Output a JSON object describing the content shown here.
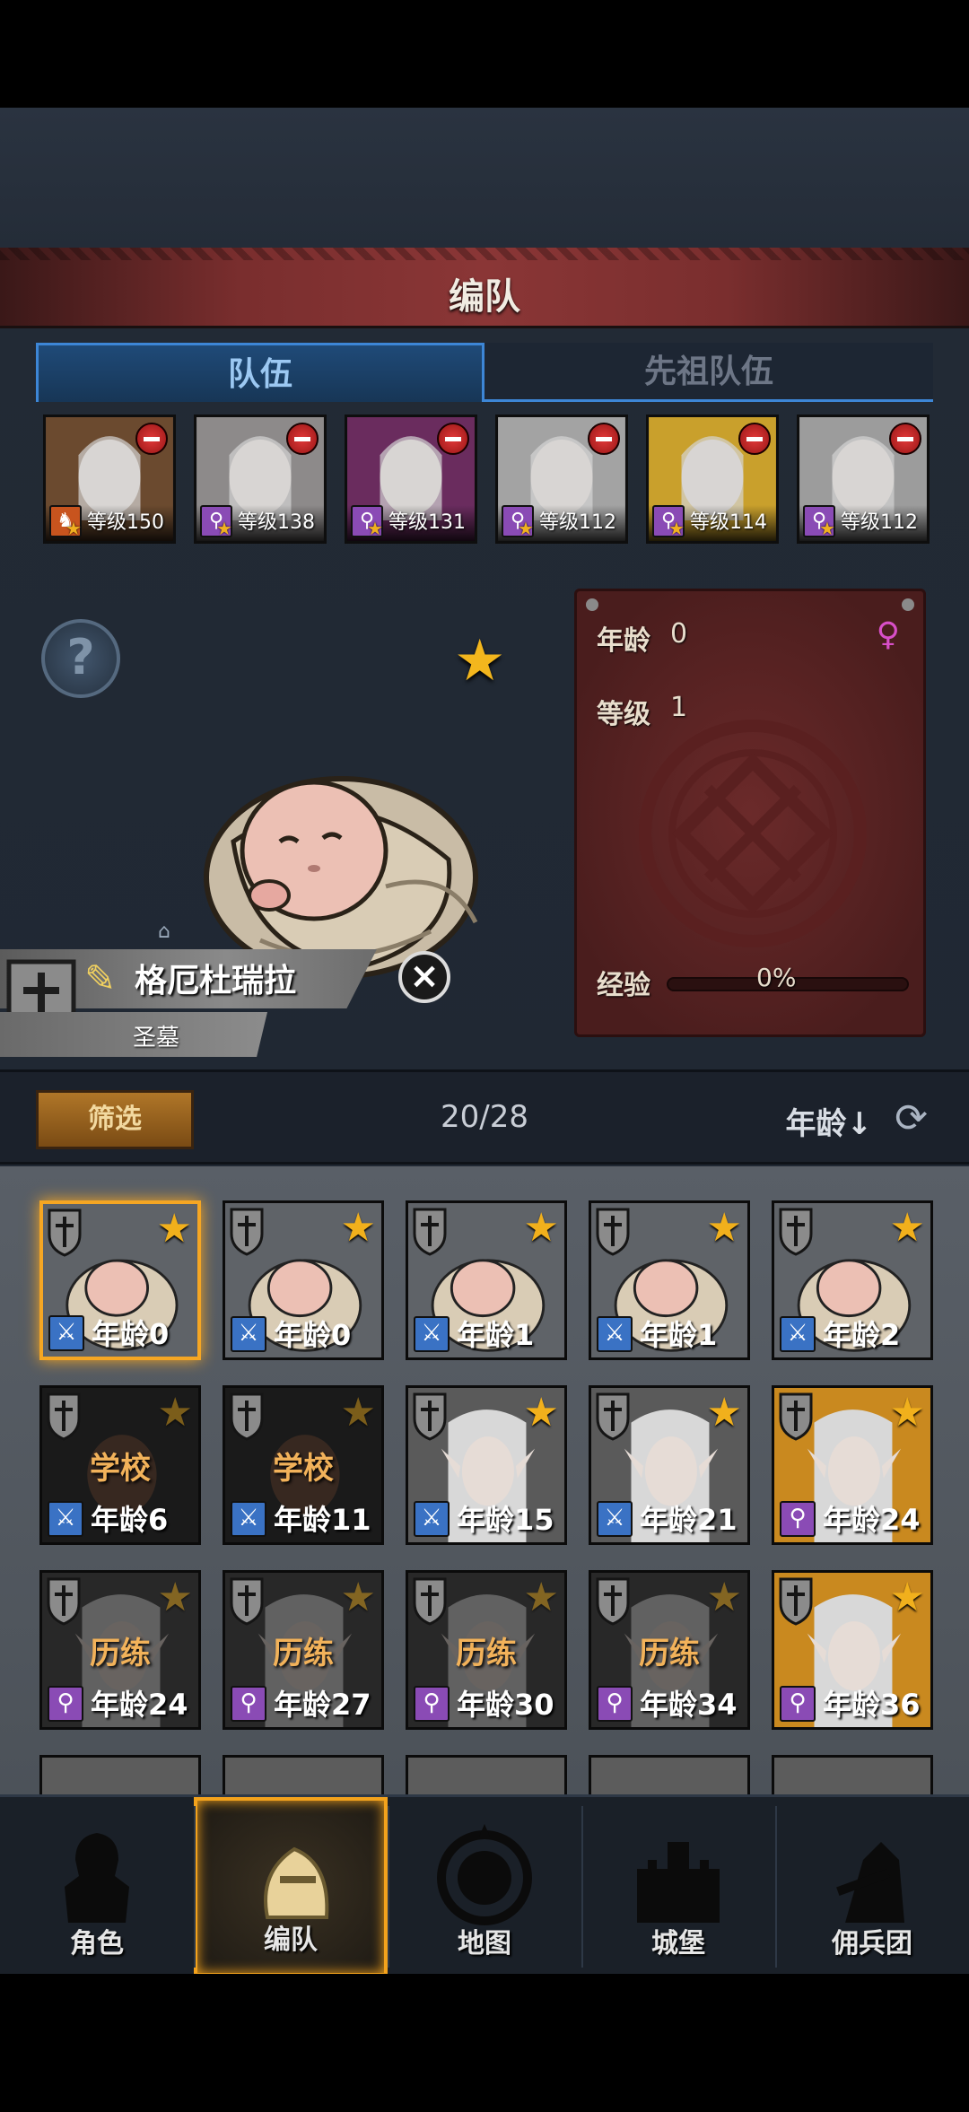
{
  "header": {
    "title": "编队"
  },
  "tabs": [
    {
      "label": "队伍",
      "active": true
    },
    {
      "label": "先祖队伍",
      "active": false
    }
  ],
  "team": [
    {
      "level_text": "等级150",
      "class_icon": "horse-icon",
      "class_color": "#c8541e"
    },
    {
      "level_text": "等级138",
      "class_icon": "staff-icon",
      "class_color": "#8a4bb5"
    },
    {
      "level_text": "等级131",
      "class_icon": "staff-icon",
      "class_color": "#8a4bb5"
    },
    {
      "level_text": "等级112",
      "class_icon": "staff-icon",
      "class_color": "#8a4bb5"
    },
    {
      "level_text": "等级114",
      "class_icon": "staff-icon",
      "class_color": "#8a4bb5"
    },
    {
      "level_text": "等级112",
      "class_icon": "staff-icon",
      "class_color": "#8a4bb5"
    }
  ],
  "selected": {
    "name": "格厄杜瑞拉",
    "subtitle": "圣墓",
    "age_label": "年龄",
    "age_value": "0",
    "level_label": "等级",
    "level_value": "1",
    "exp_label": "经验",
    "exp_value": "0%",
    "exp_fraction": 0,
    "gender_icon": "female-icon"
  },
  "filter": {
    "button": "筛选",
    "count": "20/28",
    "sort": "年龄↓"
  },
  "roster": [
    {
      "age": "年龄0",
      "status": "",
      "class": "sword",
      "selected": true,
      "kind": "baby"
    },
    {
      "age": "年龄0",
      "status": "",
      "class": "sword",
      "selected": false,
      "kind": "baby"
    },
    {
      "age": "年龄1",
      "status": "",
      "class": "sword",
      "selected": false,
      "kind": "baby"
    },
    {
      "age": "年龄1",
      "status": "",
      "class": "sword",
      "selected": false,
      "kind": "baby"
    },
    {
      "age": "年龄2",
      "status": "",
      "class": "sword",
      "selected": false,
      "kind": "baby"
    },
    {
      "age": "年龄6",
      "status": "学校",
      "class": "sword",
      "selected": false,
      "kind": "child-dim"
    },
    {
      "age": "年龄11",
      "status": "学校",
      "class": "sword",
      "selected": false,
      "kind": "child-dim"
    },
    {
      "age": "年龄15",
      "status": "",
      "class": "sword",
      "selected": false,
      "kind": "elf"
    },
    {
      "age": "年龄21",
      "status": "",
      "class": "sword",
      "selected": false,
      "kind": "elf"
    },
    {
      "age": "年龄24",
      "status": "",
      "class": "staff",
      "selected": false,
      "kind": "elf-gold"
    },
    {
      "age": "年龄24",
      "status": "历练",
      "class": "staff",
      "selected": false,
      "kind": "elf-dim"
    },
    {
      "age": "年龄27",
      "status": "历练",
      "class": "staff",
      "selected": false,
      "kind": "elf-dim"
    },
    {
      "age": "年龄30",
      "status": "历练",
      "class": "staff",
      "selected": false,
      "kind": "elf-dim"
    },
    {
      "age": "年龄34",
      "status": "历练",
      "class": "staff",
      "selected": false,
      "kind": "elf-dim"
    },
    {
      "age": "年龄36",
      "status": "",
      "class": "staff",
      "selected": false,
      "kind": "elf-gold"
    }
  ],
  "nav": [
    {
      "label": "角色",
      "icon": "knight-icon",
      "active": false
    },
    {
      "label": "编队",
      "icon": "helmet-icon",
      "active": true
    },
    {
      "label": "地图",
      "icon": "compass-icon",
      "active": false
    },
    {
      "label": "城堡",
      "icon": "castle-icon",
      "active": false
    },
    {
      "label": "佣兵团",
      "icon": "mercenary-icon",
      "active": false
    }
  ]
}
